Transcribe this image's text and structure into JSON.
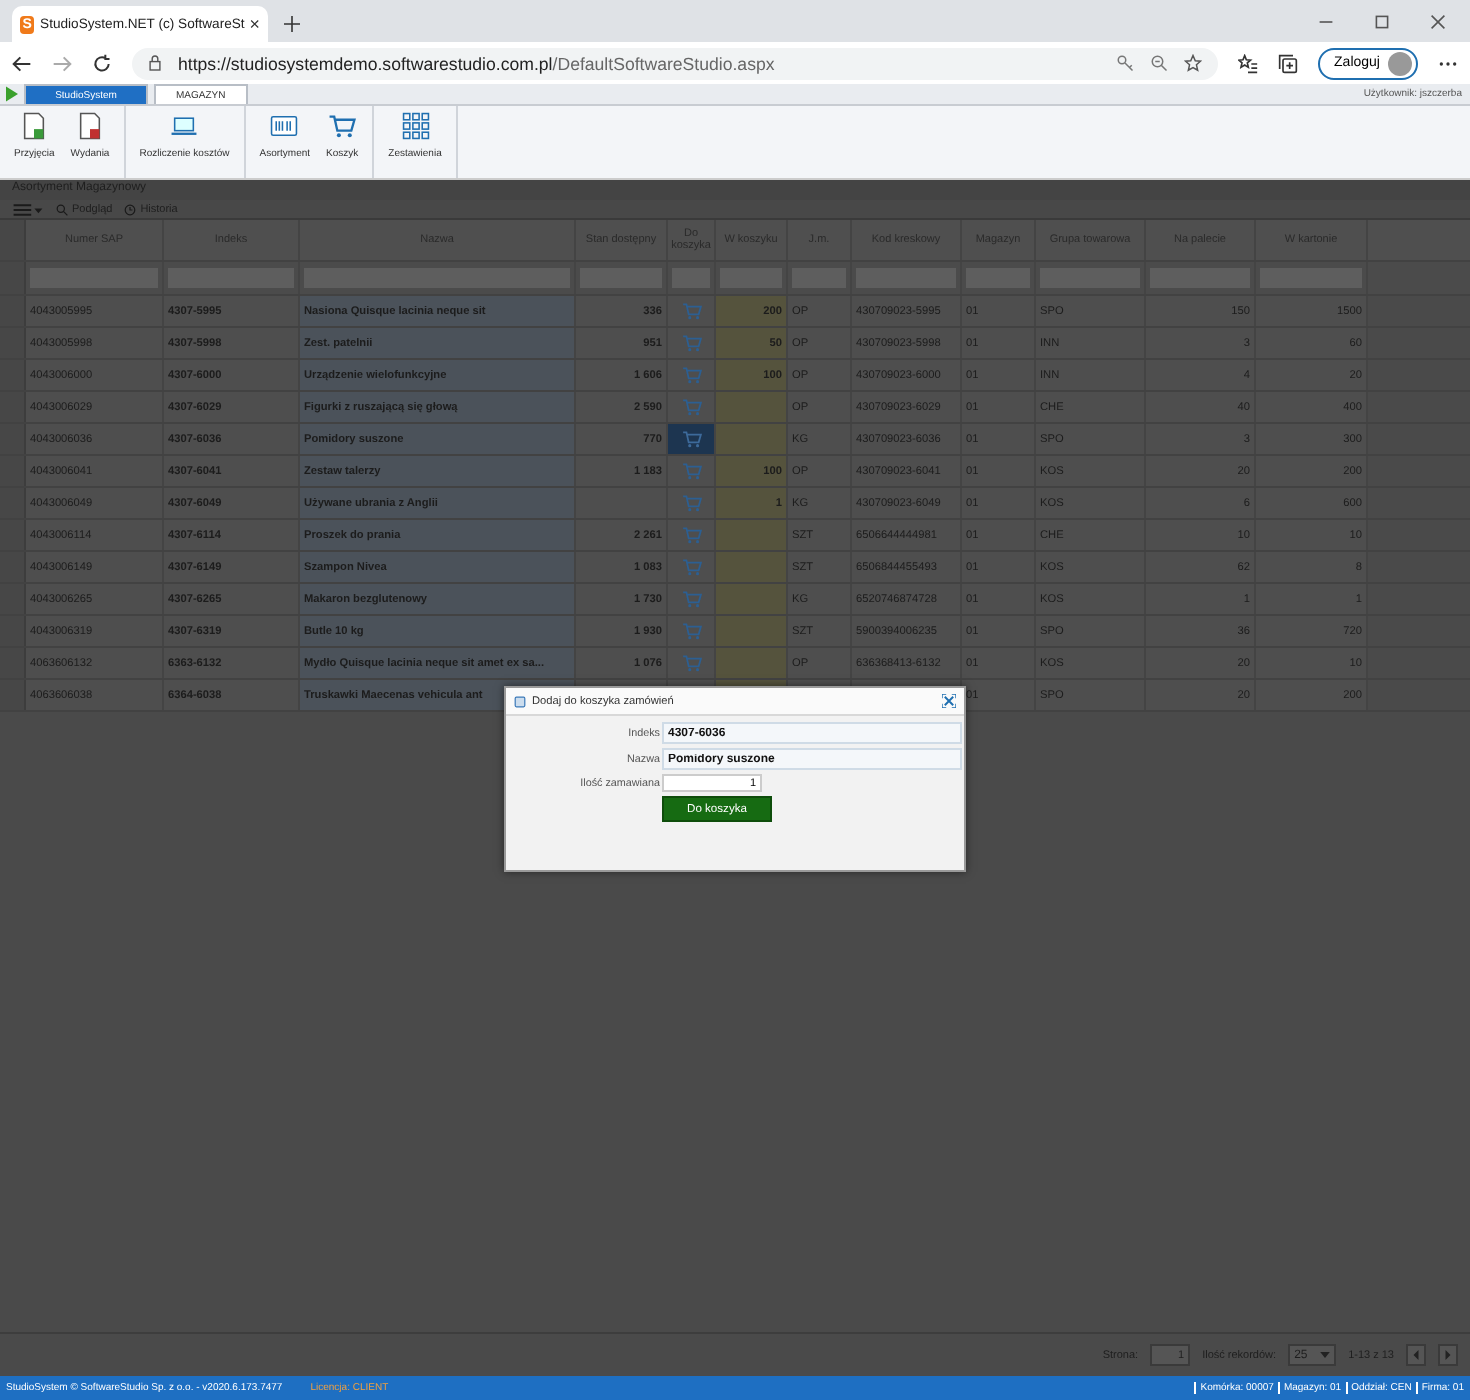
{
  "browser": {
    "favicon_letter": "S",
    "tab_title": "StudioSystem.NET (c) SoftwareSt",
    "url_host": "https://studiosystemdemo.softwarestudio.com.pl",
    "url_path": "/DefaultSoftwareStudio.aspx",
    "profile_button": "Zaloguj"
  },
  "app_tabs": [
    {
      "label": "StudioSystem",
      "selected": false
    },
    {
      "label": "MAGAZYN",
      "selected": true
    }
  ],
  "user": "Użytkownik: jszczerba",
  "ribbon": [
    [
      "Przyjęcia",
      "Wydania"
    ],
    [
      "Rozliczenie kosztów"
    ],
    [
      "Asortyment",
      "Koszyk"
    ],
    [
      "Zestawienia"
    ]
  ],
  "panel_title": "Asortyment Magazynowy",
  "toolbar": [
    "Podgląd",
    "Historia"
  ],
  "table": {
    "columns": [
      "Numer SAP",
      "Indeks",
      "Nazwa",
      "Stan dostępny",
      "Do koszyka",
      "W koszyku",
      "J.m.",
      "Kod kreskowy",
      "Magazyn",
      "Grupa towarowa",
      "Na palecie",
      "W kartonie"
    ],
    "rows": [
      {
        "selected": false,
        "cart_button": true,
        "sap": "4043005995",
        "index": "4307-5995",
        "name": "Nasiona Quisque lacinia neque sit",
        "stock": "336",
        "in_cart": "200",
        "unit": "OP",
        "barcode": "430709023-5995",
        "warehouse": "01",
        "group": "SPO",
        "per_pallet": "150",
        "per_carton": "1500"
      },
      {
        "selected": false,
        "cart_button": true,
        "sap": "4043005998",
        "index": "4307-5998",
        "name": "Zest. patelnii",
        "stock": "951",
        "in_cart": "50",
        "unit": "OP",
        "barcode": "430709023-5998",
        "warehouse": "01",
        "group": "INN",
        "per_pallet": "3",
        "per_carton": "60"
      },
      {
        "selected": false,
        "cart_button": true,
        "sap": "4043006000",
        "index": "4307-6000",
        "name": "Urządzenie wielofunkcyjne",
        "stock": "1 606",
        "in_cart": "100",
        "unit": "OP",
        "barcode": "430709023-6000",
        "warehouse": "01",
        "group": "INN",
        "per_pallet": "4",
        "per_carton": "20"
      },
      {
        "selected": false,
        "cart_button": true,
        "sap": "4043006029",
        "index": "4307-6029",
        "name": "Figurki z ruszającą się głową",
        "stock": "2 590",
        "unit": "OP",
        "barcode": "430709023-6029",
        "warehouse": "01",
        "group": "CHE",
        "per_pallet": "40",
        "per_carton": "400"
      },
      {
        "selected": true,
        "cart_button": true,
        "sap": "4043006036",
        "index": "4307-6036",
        "name": "Pomidory suszone",
        "stock": "770",
        "unit": "KG",
        "barcode": "430709023-6036",
        "warehouse": "01",
        "group": "SPO",
        "per_pallet": "3",
        "per_carton": "300"
      },
      {
        "selected": false,
        "cart_button": true,
        "sap": "4043006041",
        "index": "4307-6041",
        "name": "Zestaw talerzy",
        "stock": "1 183",
        "in_cart": "100",
        "unit": "OP",
        "barcode": "430709023-6041",
        "warehouse": "01",
        "group": "KOS",
        "per_pallet": "20",
        "per_carton": "200"
      },
      {
        "selected": false,
        "cart_button": true,
        "sap": "4043006049",
        "index": "4307-6049",
        "name": "Używane ubrania z Anglii",
        "in_cart": "1",
        "unit": "KG",
        "barcode": "430709023-6049",
        "warehouse": "01",
        "group": "KOS",
        "per_pallet": "6",
        "per_carton": "600"
      },
      {
        "selected": false,
        "cart_button": true,
        "sap": "4043006114",
        "index": "4307-6114",
        "name": "Proszek do prania",
        "stock": "2 261",
        "unit": "SZT",
        "barcode": "6506644444981",
        "warehouse": "01",
        "group": "CHE",
        "per_pallet": "10",
        "per_carton": "10"
      },
      {
        "selected": false,
        "cart_button": true,
        "sap": "4043006149",
        "index": "4307-6149",
        "name": "Szampon Nivea",
        "stock": "1 083",
        "unit": "SZT",
        "barcode": "6506844455493",
        "warehouse": "01",
        "group": "KOS",
        "per_pallet": "62",
        "per_carton": "8"
      },
      {
        "selected": false,
        "cart_button": true,
        "sap": "4043006265",
        "index": "4307-6265",
        "name": "Makaron bezglutenowy",
        "stock": "1 730",
        "unit": "KG",
        "barcode": "6520746874728",
        "warehouse": "01",
        "group": "KOS",
        "per_pallet": "1",
        "per_carton": "1"
      },
      {
        "selected": false,
        "cart_button": true,
        "sap": "4043006319",
        "index": "4307-6319",
        "name": "Butle 10 kg",
        "stock": "1 930",
        "unit": "SZT",
        "barcode": "5900394006235",
        "warehouse": "01",
        "group": "SPO",
        "per_pallet": "36",
        "per_carton": "720"
      },
      {
        "selected": false,
        "cart_button": true,
        "sap": "4063606132",
        "index": "6363-6132",
        "name": "Mydło Quisque lacinia neque sit amet ex sa...",
        "stock": "1 076",
        "unit": "OP",
        "barcode": "636368413-6132",
        "warehouse": "01",
        "group": "KOS",
        "per_pallet": "20",
        "per_carton": "10"
      },
      {
        "selected": false,
        "cart_button": false,
        "sap": "4063606038",
        "index": "6364-6038",
        "name": "Truskawki Maecenas vehicula ant",
        "warehouse": "01",
        "group": "SPO",
        "per_pallet": "20",
        "per_carton": "200"
      }
    ]
  },
  "pager": {
    "page_label": "Strona:",
    "page": "1",
    "records_label": "Ilość rekordów:",
    "records": "25",
    "range": "1-13 z 13"
  },
  "dialog": {
    "title": "Dodaj do koszyka zamówień",
    "fields": [
      {
        "label": "Indeks",
        "value": "4307-6036",
        "kind": "readonly"
      },
      {
        "label": "Nazwa",
        "value": "Pomidory suszone",
        "kind": "readonly"
      },
      {
        "label": "Ilość zamawiana",
        "value": "1",
        "kind": "number"
      }
    ],
    "button": "Do koszyka"
  },
  "status_bar": {
    "copyright": "StudioSystem © SoftwareStudio Sp. z o.o. - v2020.6.173.7477",
    "license": "Licencja: CLIENT",
    "items": [
      "Komórka: 00007",
      "Magazyn: 01",
      "Oddział: CEN",
      "Firma: 01"
    ]
  }
}
